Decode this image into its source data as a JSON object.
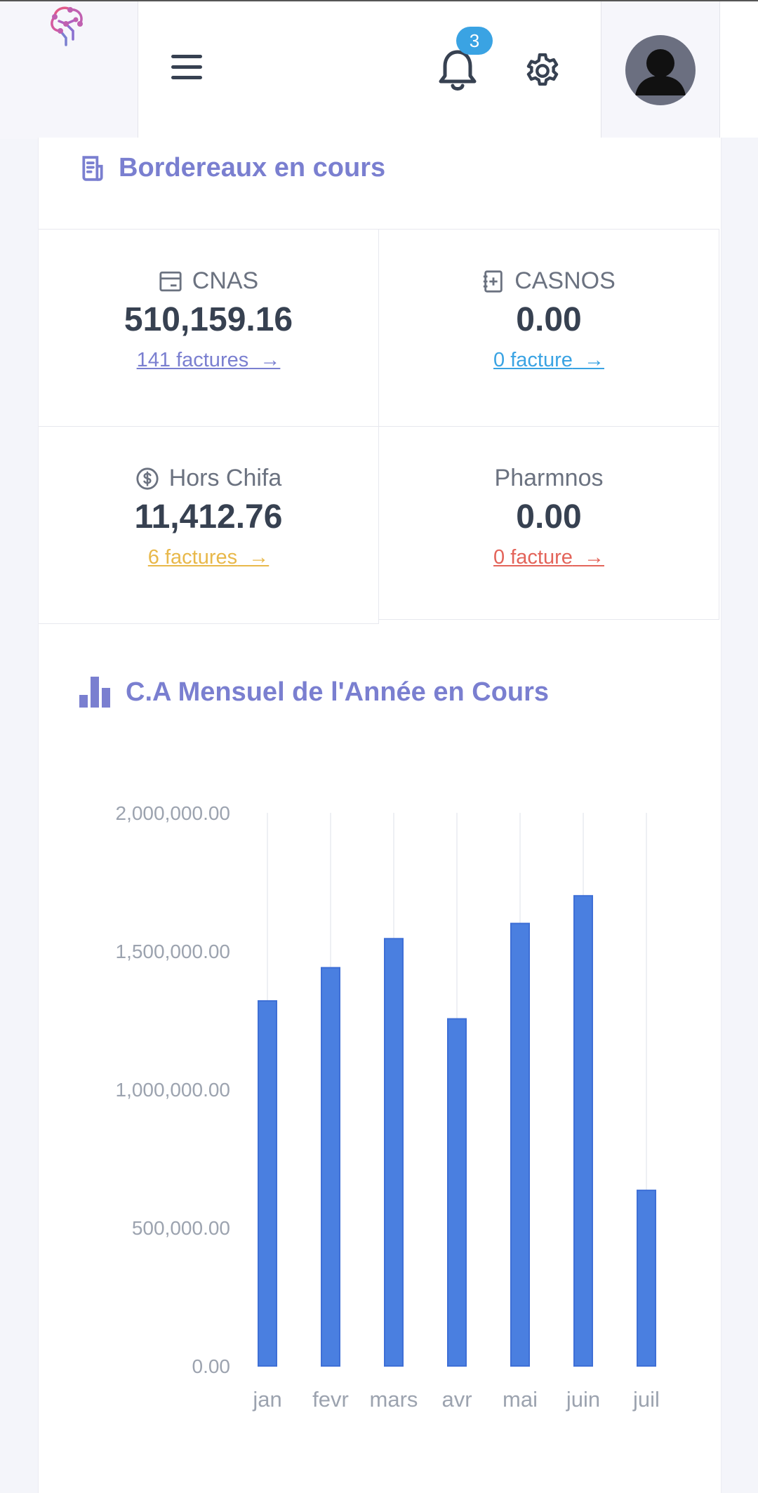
{
  "header": {
    "notification_count": "3",
    "icons": [
      "logo-icon",
      "menu-icon",
      "bell-icon",
      "gear-icon",
      "avatar-icon"
    ]
  },
  "bordereaux": {
    "title": "Bordereaux en cours",
    "cells": [
      {
        "label": "CNAS",
        "amount": "510,159.16",
        "link": "141 factures",
        "color": "#7a7fd0",
        "icon": "card-icon"
      },
      {
        "label": "CASNOS",
        "amount": "0.00",
        "link": "0 facture",
        "color": "#3aa3e3",
        "icon": "add-document-icon"
      },
      {
        "label": "Hors Chifa",
        "amount": "11,412.76",
        "link": "6 factures",
        "color": "#e8b84a",
        "icon": "dollar-circle-icon"
      },
      {
        "label": "Pharmnos",
        "amount": "0.00",
        "link": "0 facture",
        "color": "#e3645a",
        "icon": ""
      }
    ]
  },
  "chart_section": {
    "title": "C.A Mensuel de l'Année en Cours"
  },
  "chart_data": {
    "type": "bar",
    "categories": [
      "jan",
      "fevr",
      "mars",
      "avr",
      "mai",
      "juin",
      "juil"
    ],
    "values": [
      1320000,
      1440000,
      1545000,
      1255000,
      1600000,
      1700000,
      635000
    ],
    "ylim": [
      0,
      2000000
    ],
    "yticks": [
      0,
      500000,
      1000000,
      1500000,
      2000000
    ],
    "ytick_labels": [
      "0.00",
      "500,000.00",
      "1,000,000.00",
      "1,500,000.00",
      "2,000,000.00"
    ],
    "bar_color": "#4a7fe0",
    "grid": true
  }
}
